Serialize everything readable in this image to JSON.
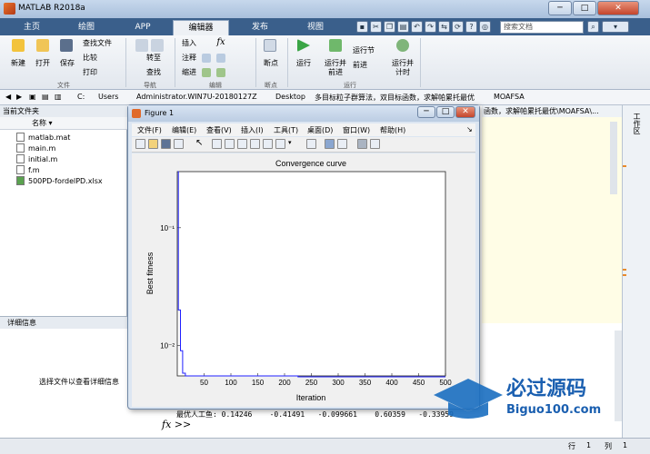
{
  "window": {
    "title": "MATLAB R2018a",
    "minimize": "─",
    "maximize": "□",
    "close": "✕"
  },
  "tabs": [
    {
      "label": "主页",
      "active": false
    },
    {
      "label": "绘图",
      "active": false
    },
    {
      "label": "APP",
      "active": false
    },
    {
      "label": "编辑器",
      "active": true
    },
    {
      "label": "发布",
      "active": false
    },
    {
      "label": "视图",
      "active": false
    }
  ],
  "search_placeholder": "搜索文档",
  "ribbon": {
    "file": {
      "new": "新建",
      "open": "打开",
      "save": "保存",
      "find_files": "查找文件",
      "compare": "比较",
      "print": "打印",
      "group": "文件"
    },
    "nav": {
      "goto": "转至",
      "find": "查找",
      "group": "导航"
    },
    "edit": {
      "insert": "插入",
      "comment": "注释",
      "indent": "缩进",
      "fx": "fx",
      "group": "编辑"
    },
    "breakpoints": {
      "label": "断点",
      "group": "断点"
    },
    "run": {
      "run": "运行",
      "run_advance": "运行并\n前进",
      "run_section": "运行节",
      "advance": "前进",
      "run_time": "运行并\n计时",
      "group": "运行"
    }
  },
  "address": {
    "segments": [
      "C:",
      "Users",
      "Administrator.WIN7U-20180127Z",
      "Desktop",
      "多目标粒子群算法，双目标函数，求解帕累托最优",
      "MOAFSA"
    ]
  },
  "file_panel": {
    "header": "当前文件夹",
    "column": "名称 ▾",
    "files": [
      "matlab.mat",
      "main.m",
      "initial.m",
      "f.m",
      "500PD-fordelPD.xlsx"
    ]
  },
  "detail_panel": {
    "header": "详细信息",
    "text": "选择文件以查看详细信息"
  },
  "editor_path_tail": "函数，求解帕累托最优\\MOAFSA\\...",
  "right_strip": "工作区",
  "command": {
    "result_line": "最优人工鱼: 0.14246    -0.41491   -0.099661    0.60359   -0.33959",
    "prompt": "fx >>"
  },
  "status": {
    "row_label": "行",
    "row": "1",
    "col_label": "列",
    "col": "1"
  },
  "figure": {
    "title": "Figure 1",
    "menu": [
      "文件(F)",
      "编辑(E)",
      "查看(V)",
      "插入(I)",
      "工具(T)",
      "桌面(D)",
      "窗口(W)",
      "帮助(H)"
    ],
    "menu_arrow": "↘"
  },
  "chart_data": {
    "type": "line",
    "title": "Convergence curve",
    "xlabel": "Iteration",
    "ylabel": "Best fitness",
    "yscale": "log",
    "xlim": [
      0,
      500
    ],
    "ylim": [
      0.0055,
      0.3
    ],
    "xticks": [
      50,
      100,
      150,
      200,
      250,
      300,
      350,
      400,
      450,
      500
    ],
    "yticks": [
      0.01,
      0.1
    ],
    "ytick_labels": [
      "10⁻²",
      "10⁻¹"
    ],
    "series": [
      {
        "color": "#1f1fff",
        "x": [
          1,
          2,
          2,
          6,
          6,
          10,
          10,
          15,
          15,
          225,
          225,
          500
        ],
        "y": [
          0.3,
          0.3,
          0.02,
          0.02,
          0.009,
          0.009,
          0.0058,
          0.0058,
          0.0055,
          0.0055,
          0.0054,
          0.0054
        ]
      }
    ],
    "grid": false
  },
  "watermark": {
    "main": "必过源码",
    "sub": "Biguo100.com"
  }
}
